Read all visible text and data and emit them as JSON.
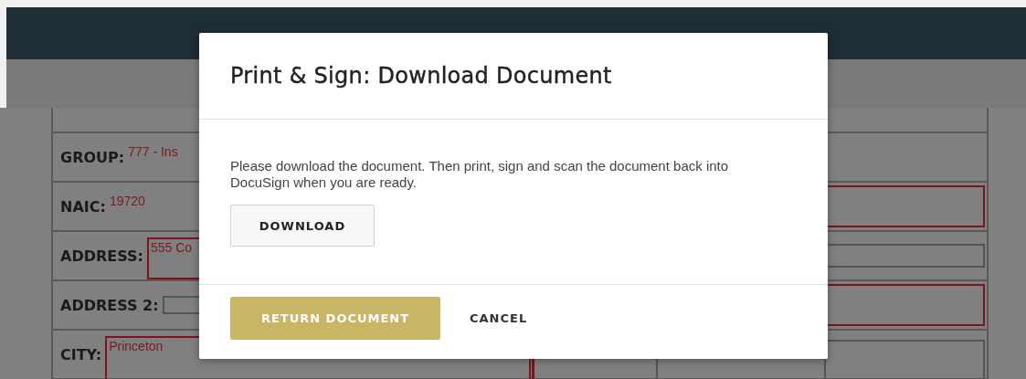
{
  "form": {
    "rows": [
      {
        "kind": "clipped"
      },
      {
        "label": "GROUP:",
        "value": "777 - Ins",
        "kind": "text"
      },
      {
        "label": "NAIC:",
        "value": "19720",
        "kind": "text",
        "right_field": {
          "kind": "required"
        }
      },
      {
        "label": "ADDRESS:",
        "value": "555 Co",
        "kind": "required",
        "right_field": {
          "kind": "optional"
        }
      },
      {
        "label": "ADDRESS 2:",
        "kind": "optional",
        "right_field": {
          "kind": "required"
        }
      },
      {
        "label": "CITY:",
        "value": "Princeton",
        "kind": "required",
        "right_field": {
          "kind": "labelled"
        }
      }
    ]
  },
  "dialog": {
    "title": "Print & Sign: Download Document",
    "message": "Please download the document. Then print, sign and scan the document back into DocuSign when you are ready.",
    "download_button": "DOWNLOAD",
    "primary_button": "RETURN DOCUMENT",
    "cancel_button": "CANCEL"
  }
}
